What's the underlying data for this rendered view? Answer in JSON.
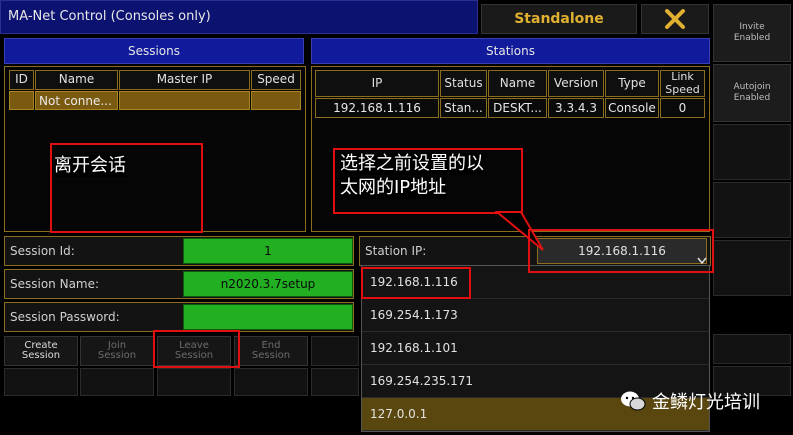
{
  "window": {
    "title": "MA-Net Control (Consoles only)",
    "mode": "Standalone",
    "close_icon": "close-x-icon"
  },
  "right_buttons": [
    {
      "label": "Invite\nEnabled"
    },
    {
      "label": "Autojoin\nEnabled"
    }
  ],
  "sessions": {
    "header": "Sessions",
    "columns": [
      "ID",
      "Name",
      "Master IP",
      "Speed"
    ],
    "rows": [
      {
        "id": "",
        "name": "Not conne...",
        "master_ip": "",
        "speed": ""
      }
    ]
  },
  "stations": {
    "header": "Stations",
    "columns": [
      "IP",
      "Status",
      "Name",
      "Version",
      "Type",
      "Link\nSpeed"
    ],
    "rows": [
      {
        "ip": "192.168.1.116",
        "status": "Stan...",
        "name": "DESKT...",
        "version": "3.3.4.3",
        "type": "Console",
        "link_speed": "0"
      }
    ]
  },
  "fields": {
    "session_id": {
      "label": "Session Id:",
      "value": "1"
    },
    "session_name": {
      "label": "Session Name:",
      "value": "n2020.3.7setup"
    },
    "session_password": {
      "label": "Session Password:",
      "value": ""
    },
    "station_ip": {
      "label": "Station IP:",
      "value": "192.168.1.116"
    }
  },
  "session_buttons": [
    {
      "label": "Create\nSession"
    },
    {
      "label": "Join\nSession"
    },
    {
      "label": "Leave\nSession"
    },
    {
      "label": "End\nSession"
    }
  ],
  "ip_dropdown": [
    "192.168.1.116",
    "169.254.1.173",
    "192.168.1.101",
    "169.254.235.171",
    "127.0.0.1"
  ],
  "annotations": {
    "leave": "离开会话",
    "select_ip_line1": "选择之前设置的以",
    "select_ip_line2": "太网的IP地址"
  },
  "watermark": "金鳞灯光培训",
  "colors": {
    "title_bar": "#0c1270",
    "header": "#101a9a",
    "accent_gold": "#e0b030",
    "field_green": "#22b022",
    "highlight_red": "#e01010"
  }
}
